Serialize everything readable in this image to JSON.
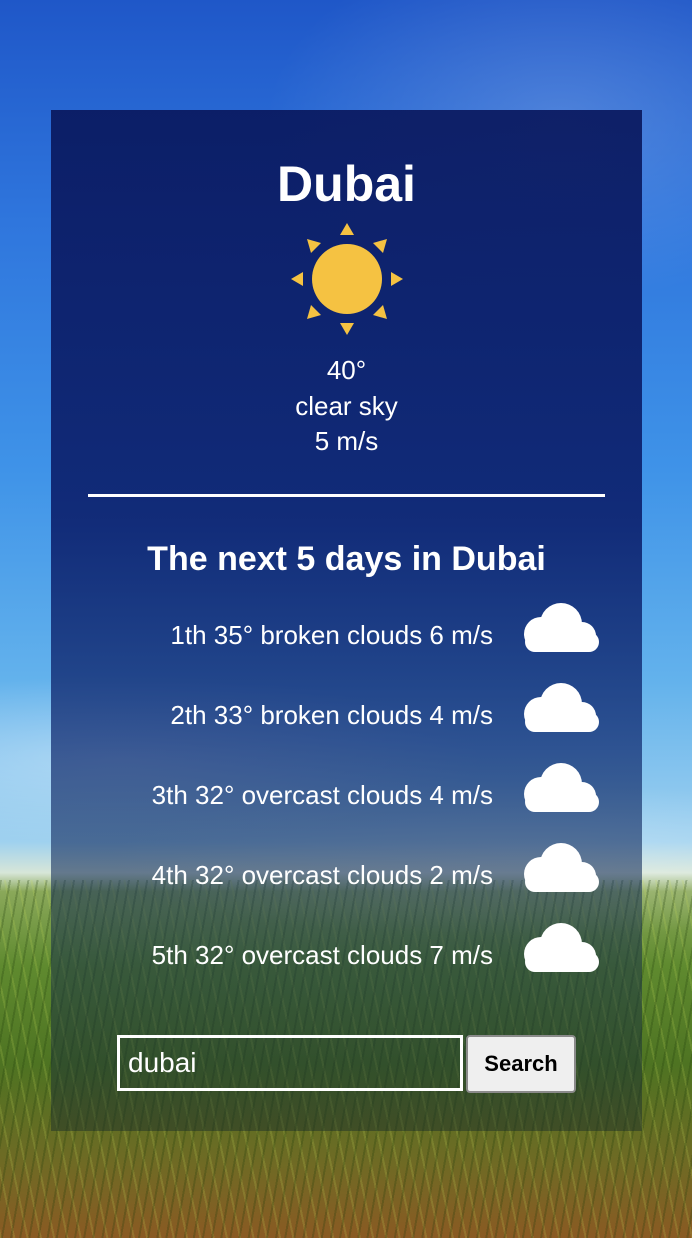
{
  "current": {
    "city": "Dubai",
    "icon": "sun-icon",
    "temperature": "40°",
    "description": "clear sky",
    "wind": "5 m/s"
  },
  "forecast": {
    "title": "The next 5 days in Dubai",
    "days": [
      {
        "text": "1th 35° broken clouds 6 m/s",
        "icon": "cloud-icon"
      },
      {
        "text": "2th 33° broken clouds 4 m/s",
        "icon": "cloud-icon"
      },
      {
        "text": "3th 32° overcast clouds 4 m/s",
        "icon": "cloud-icon"
      },
      {
        "text": "4th 32° overcast clouds 2 m/s",
        "icon": "cloud-icon"
      },
      {
        "text": "5th 32° overcast clouds 7 m/s",
        "icon": "cloud-icon"
      }
    ]
  },
  "search": {
    "value": "dubai",
    "button_label": "Search"
  },
  "colors": {
    "sun": "#f5c242",
    "card": "#0c1e64",
    "text": "#ffffff"
  }
}
